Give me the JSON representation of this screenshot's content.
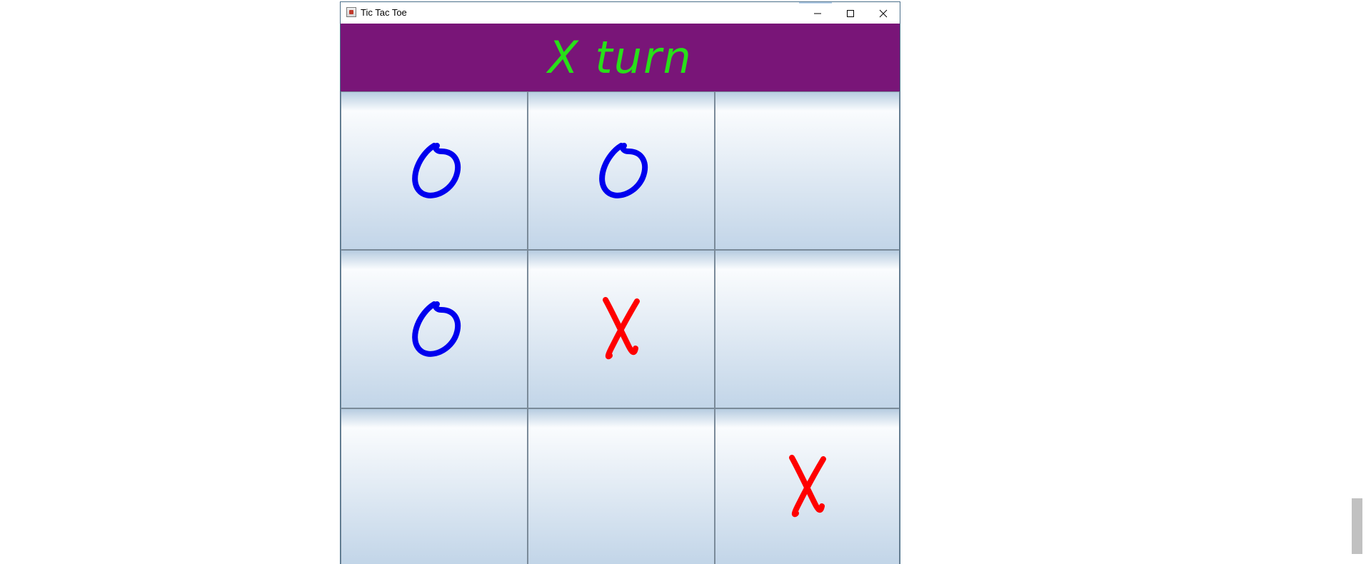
{
  "window": {
    "title": "Tic Tac Toe"
  },
  "banner": {
    "text": "X turn",
    "background_color": "#791578",
    "text_color": "#28e019"
  },
  "board": {
    "cells": [
      "O",
      "O",
      "",
      "O",
      "X",
      "",
      "",
      "",
      "X"
    ],
    "o_color": "#0000ee",
    "x_color": "#ff0000"
  },
  "icons": {
    "app": "java-app-icon",
    "minimize": "minimize-icon",
    "maximize": "maximize-icon",
    "close": "close-icon"
  }
}
